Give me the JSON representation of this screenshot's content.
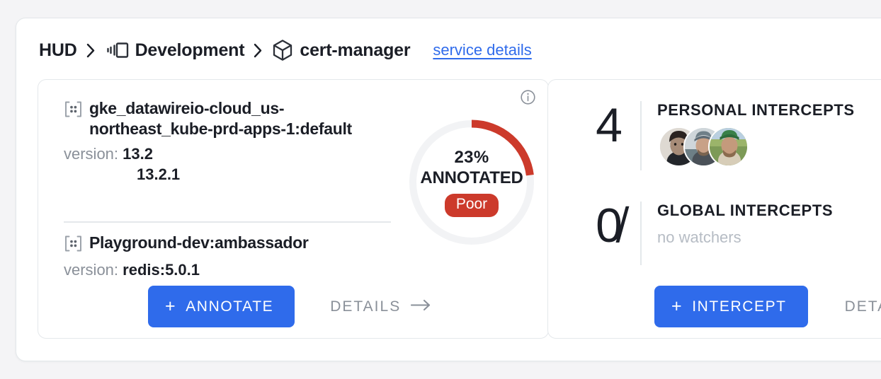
{
  "breadcrumb": {
    "root_label": "HUD",
    "separator": "›",
    "environment_icon": "layers-icon",
    "environment_label": "Development",
    "service_icon": "cube-icon",
    "service_label": "cert-manager",
    "service_details_link": "service details"
  },
  "left_card": {
    "info_icon": "info-circle-icon",
    "clusters": [
      {
        "icon": "cluster-brackets-icon",
        "name": "gke_datawireio-cloud_us-northeast_kube-prd-apps-1:default",
        "version_label": "version: ",
        "version_value": "13.2",
        "version_extra": "13.2.1"
      },
      {
        "icon": "cluster-brackets-icon",
        "name": "Playground-dev:ambassador",
        "version_label": "version: ",
        "version_value": "redis:5.0.1",
        "version_extra": ""
      }
    ],
    "gauge": {
      "percent_text": "23%",
      "label": "ANNOTATED",
      "badge": "Poor",
      "value": 23,
      "track_color": "#f2f3f5",
      "arc_color": "#cc3a2b"
    },
    "primary_button": "ANNOTATE",
    "primary_button_icon": "plus-icon",
    "ghost_button": "DETAILS",
    "ghost_button_icon": "arrow-right-icon"
  },
  "right_card": {
    "stats": [
      {
        "number": "4",
        "title": "PERSONAL INTERCEPTS",
        "subtitle": "",
        "has_avatars": true,
        "avatar_count": 3
      },
      {
        "number": "0̸",
        "title": "GLOBAL INTERCEPTS",
        "subtitle": "no watchers",
        "has_avatars": false,
        "avatar_count": 0
      }
    ],
    "primary_button": "INTERCEPT",
    "primary_button_icon": "plus-icon",
    "ghost_button": "DETAILS",
    "ghost_button_icon": "arrow-right-icon"
  },
  "colors": {
    "accent_blue": "#2f6beb",
    "danger_red": "#cc3a2b",
    "text_dark": "#1b1e26",
    "text_muted": "#8a9099",
    "border": "#e4e8eb",
    "page_bg": "#f4f4f6"
  }
}
